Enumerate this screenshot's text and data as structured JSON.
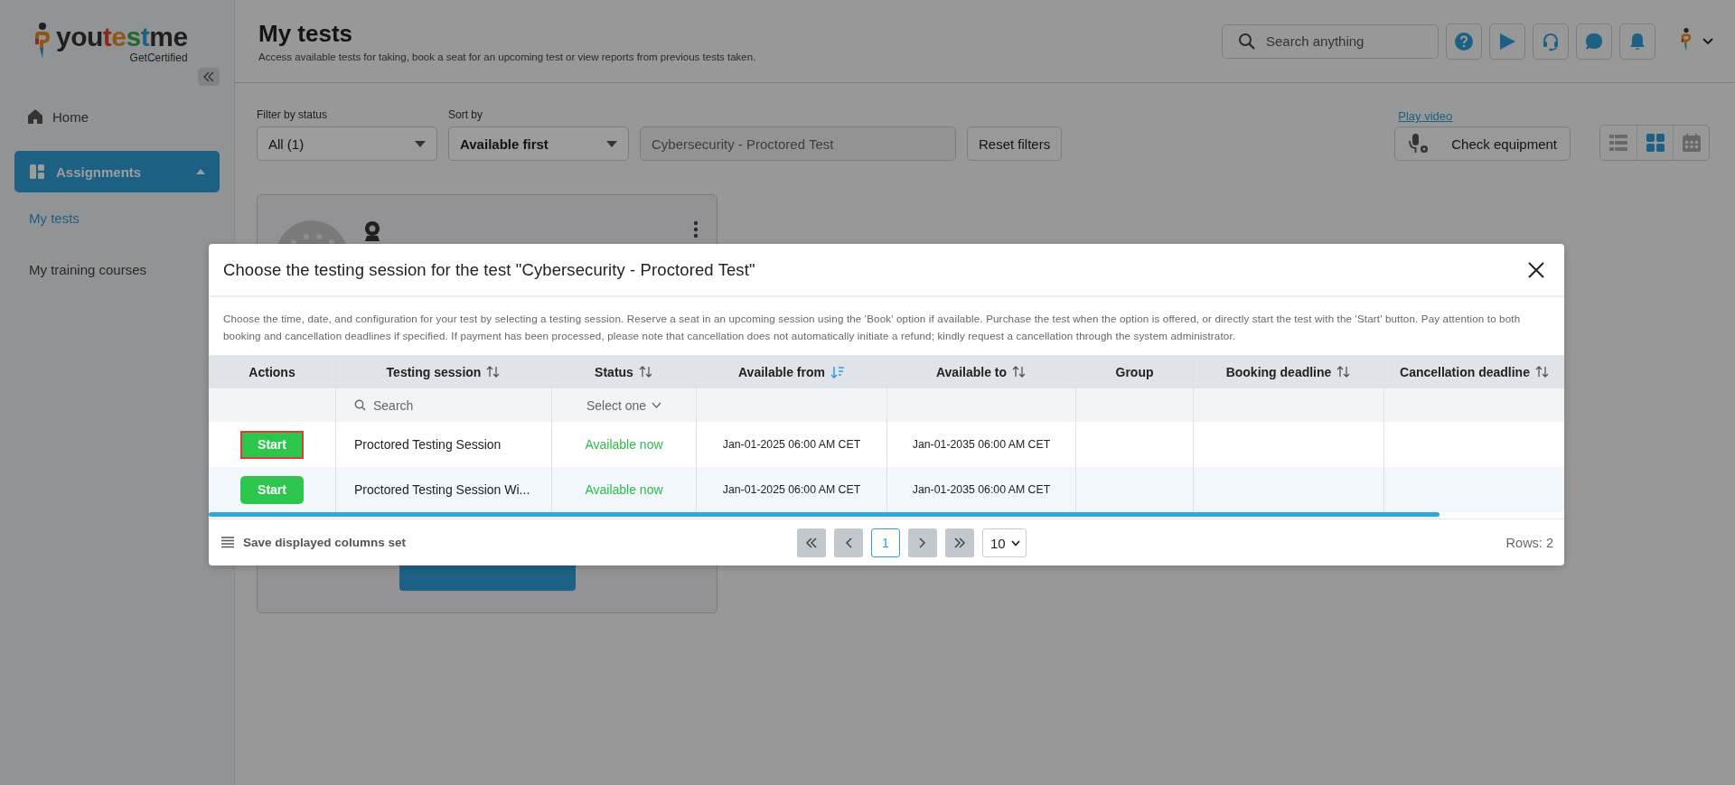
{
  "logo": {
    "name": "youtestme",
    "tagline": "GetCertified"
  },
  "sidebar": {
    "items": [
      {
        "label": "Home",
        "kind": "link",
        "selected": false
      },
      {
        "label": "Assignments",
        "kind": "group",
        "selected": true,
        "expanded": true,
        "children": [
          {
            "label": "My tests",
            "selected": true
          },
          {
            "label": "My training courses",
            "selected": false
          }
        ]
      }
    ]
  },
  "header": {
    "title": "My tests",
    "subtitle": "Access available tests for taking, book a seat for an upcoming test or view reports from previous tests taken.",
    "search_placeholder": "Search anything"
  },
  "filters": {
    "status_label": "Filter by status",
    "status_value": "All (1)",
    "sort_label": "Sort by",
    "sort_value": "Available first",
    "search_value": "Cybersecurity - Proctored Test",
    "reset_label": "Reset filters",
    "play_video": "Play video",
    "check_equipment": "Check equipment",
    "views": [
      {
        "kind": "list",
        "selected": false
      },
      {
        "kind": "grid",
        "selected": true
      },
      {
        "kind": "calendar",
        "selected": false
      }
    ]
  },
  "modal": {
    "title": "Choose the testing session for the test \"Cybersecurity - Proctored Test\"",
    "description": "Choose the time, date, and configuration for your test by selecting a testing session. Reserve a seat in an upcoming session using the 'Book' option if available. Purchase the test when the option is offered, or directly start the test with the 'Start' button. Pay attention to both booking and cancellation deadlines if specified. If payment has been processed, please note that cancellation does not automatically initiate a refund; kindly request a cancellation through the system administrator.",
    "columns": [
      {
        "label": "Actions",
        "sortable": false
      },
      {
        "label": "Testing session",
        "sortable": true
      },
      {
        "label": "Status",
        "sortable": true
      },
      {
        "label": "Available from",
        "sortable": true,
        "sorted": true
      },
      {
        "label": "Available to",
        "sortable": true
      },
      {
        "label": "Group",
        "sortable": false
      },
      {
        "label": "Booking deadline",
        "sortable": true
      },
      {
        "label": "Cancellation deadline",
        "sortable": true
      }
    ],
    "filter_row": {
      "search_placeholder": "Search",
      "status_placeholder": "Select one"
    },
    "rows": [
      {
        "action": "Start",
        "focused": true,
        "session": "Proctored Testing Session",
        "status": "Available now",
        "from": "Jan-01-2025 06:00 AM CET",
        "to": "Jan-01-2035 06:00 AM CET"
      },
      {
        "action": "Start",
        "focused": false,
        "session": "Proctored Testing Session Wi...",
        "status": "Available now",
        "from": "Jan-01-2025 06:00 AM CET",
        "to": "Jan-01-2035 06:00 AM CET"
      }
    ],
    "footer": {
      "save_label": "Save displayed columns set",
      "page": "1",
      "page_size": "10",
      "rows": "Rows: 2"
    }
  }
}
